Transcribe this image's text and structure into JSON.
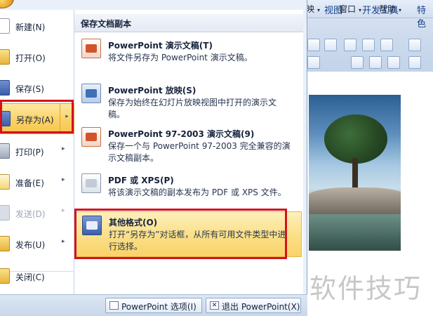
{
  "ribbon": {
    "tabs": [
      "视图",
      "开发工具",
      "特色"
    ],
    "menus": [
      {
        "label": "映",
        "arrow": "▾"
      },
      {
        "label": "窗口",
        "arrow": "▾"
      },
      {
        "label": "帮助",
        "arrow": "▾"
      }
    ]
  },
  "office_menu": {
    "left_items": [
      {
        "label": "新建(N)",
        "icon": "new-document-icon",
        "submenu": ""
      },
      {
        "label": "打开(O)",
        "icon": "open-folder-icon",
        "submenu": ""
      },
      {
        "label": "保存(S)",
        "icon": "save-icon",
        "submenu": ""
      },
      {
        "label": "另存为(A)",
        "icon": "save-as-icon",
        "submenu": "▸"
      },
      {
        "label": "打印(P)",
        "icon": "printer-icon",
        "submenu": "▸"
      },
      {
        "label": "准备(E)",
        "icon": "prepare-icon",
        "submenu": "▸"
      },
      {
        "label": "发送(D)",
        "icon": "send-icon",
        "submenu": "▸"
      },
      {
        "label": "发布(U)",
        "icon": "publish-icon",
        "submenu": "▸"
      },
      {
        "label": "关闭(C)",
        "icon": "close-folder-icon",
        "submenu": ""
      }
    ],
    "section_header": "保存文档副本",
    "options": [
      {
        "title": "PowerPoint 演示文稿(T)",
        "desc": "将文件另存为 PowerPoint 演示文稿。",
        "icon": "powerpoint-presentation-icon"
      },
      {
        "title": "PowerPoint 放映(S)",
        "desc": "保存为始终在幻灯片放映视图中打开的演示文稿。",
        "icon": "powerpoint-show-icon"
      },
      {
        "title": "PowerPoint 97-2003 演示文稿(9)",
        "desc": "保存一个与 PowerPoint 97-2003 完全兼容的演示文稿副本。",
        "icon": "powerpoint-97-icon"
      },
      {
        "title": "PDF 或 XPS(P)",
        "desc": "将该演示文稿的副本发布为 PDF 或 XPS 文件。",
        "icon": "pdf-xps-icon"
      },
      {
        "title": "其他格式(O)",
        "desc": "打开“另存为”对话框，从所有可用文件类型中进行选择。",
        "icon": "other-formats-icon"
      }
    ],
    "bottom": {
      "options_label": "PowerPoint 选项(I)",
      "exit_label": "退出 PowerPoint(X)",
      "exit_icon_glyph": "✕"
    }
  },
  "watermark": "软件技巧",
  "colors": {
    "highlight_red": "#d5121b",
    "hover_gold": "#fbd36a",
    "menu_blue": "#e9f0f9"
  }
}
